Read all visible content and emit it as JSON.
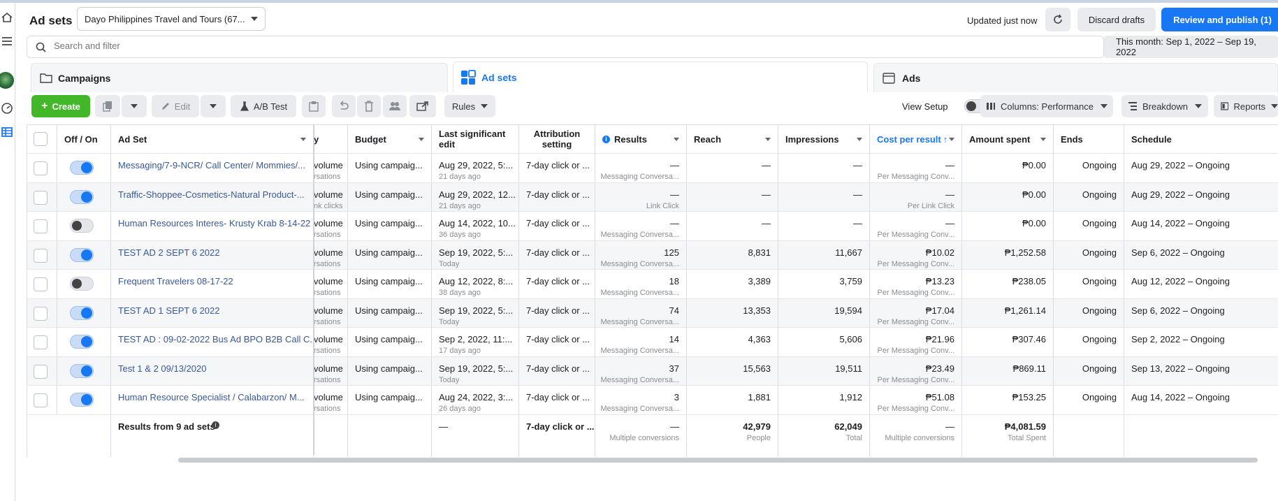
{
  "header": {
    "title": "Ad sets",
    "account": "Dayo Philippines Travel and Tours (67...",
    "updated": "Updated just now",
    "discard": "Discard drafts",
    "publish": "Review and publish (1)"
  },
  "search": {
    "placeholder": "Search and filter"
  },
  "date_range": "This month: Sep 1, 2022 – Sep 19, 2022",
  "tabs": [
    {
      "label": "Campaigns"
    },
    {
      "label": "Ad sets"
    },
    {
      "label": "Ads"
    }
  ],
  "toolbar": {
    "create": "Create",
    "edit": "Edit",
    "ab_test": "A/B Test",
    "rules": "Rules",
    "view_setup": "View Setup",
    "columns": "Columns: Performance",
    "breakdown": "Breakdown",
    "reports": "Reports"
  },
  "columns": {
    "off_on": "Off / On",
    "ad_set": "Ad Set",
    "delivery": "y",
    "budget": "Budget",
    "last_edit": "Last significant edit",
    "attribution": "Attribution setting",
    "results": "Results",
    "reach": "Reach",
    "impressions": "Impressions",
    "cpr": "Cost per result",
    "spent": "Amount spent",
    "ends": "Ends",
    "schedule": "Schedule"
  },
  "rows": [
    {
      "on": true,
      "name": "Messaging/7-9-NCR/ Call Center/ Mommies/...",
      "del": "volume",
      "del_sub": "rsations",
      "budget": "Using campaig...",
      "edit": "Aug 29, 2022, 5:...",
      "edit_sub": "21 days ago",
      "attr": "7-day click or ...",
      "results": "—",
      "results_sub": "Messaging Conversa...",
      "reach": "—",
      "impr": "—",
      "cpr": "—",
      "cpr_sub": "Per Messaging Conv...",
      "spent": "₱0.00",
      "ends": "Ongoing",
      "schedule": "Aug 29, 2022 – Ongoing"
    },
    {
      "on": true,
      "name": "Traffic-Shoppee-Cosmetics-Natural Product-...",
      "del": "volume",
      "del_sub": "nk clicks",
      "budget": "Using campaig...",
      "edit": "Aug 29, 2022, 12...",
      "edit_sub": "21 days ago",
      "attr": "7-day click or ...",
      "results": "—",
      "results_sub": "Link Click",
      "reach": "—",
      "impr": "—",
      "cpr": "—",
      "cpr_sub": "Per Link Click",
      "spent": "₱0.00",
      "ends": "Ongoing",
      "schedule": "Aug 29, 2022 – Ongoing"
    },
    {
      "on": false,
      "name": "Human Resources Interes- Krusty Krab 8-14-22",
      "del": "volume",
      "del_sub": "rsations",
      "budget": "Using campaig...",
      "edit": "Aug 14, 2022, 10...",
      "edit_sub": "36 days ago",
      "attr": "7-day click or ...",
      "results": "—",
      "results_sub": "Messaging Conversa...",
      "reach": "—",
      "impr": "—",
      "cpr": "—",
      "cpr_sub": "Per Messaging Conv...",
      "spent": "₱0.00",
      "ends": "Ongoing",
      "schedule": "Aug 14, 2022 – Ongoing"
    },
    {
      "on": true,
      "name": "TEST AD 2 SEPT 6 2022",
      "del": "volume",
      "del_sub": "rsations",
      "budget": "Using campaig...",
      "edit": "Sep 19, 2022, 5:...",
      "edit_sub": "Today",
      "attr": "7-day click or ...",
      "results": "125",
      "results_sub": "Messaging Conversa...",
      "reach": "8,831",
      "impr": "11,667",
      "cpr": "₱10.02",
      "cpr_sub": "Per Messaging Conv...",
      "spent": "₱1,252.58",
      "ends": "Ongoing",
      "schedule": "Sep 6, 2022 – Ongoing"
    },
    {
      "on": false,
      "name": "Frequent Travelers 08-17-22",
      "del": "volume",
      "del_sub": "rsations",
      "budget": "Using campaig...",
      "edit": "Aug 12, 2022, 8:...",
      "edit_sub": "38 days ago",
      "attr": "7-day click or ...",
      "results": "18",
      "results_sub": "Messaging Conversa...",
      "reach": "3,389",
      "impr": "3,759",
      "cpr": "₱13.23",
      "cpr_sub": "Per Messaging Conv...",
      "spent": "₱238.05",
      "ends": "Ongoing",
      "schedule": "Aug 12, 2022 – Ongoing"
    },
    {
      "on": true,
      "name": "TEST AD 1 SEPT 6 2022",
      "del": "volume",
      "del_sub": "rsations",
      "budget": "Using campaig...",
      "edit": "Sep 19, 2022, 5:...",
      "edit_sub": "Today",
      "attr": "7-day click or ...",
      "results": "74",
      "results_sub": "Messaging Conversa...",
      "reach": "13,353",
      "impr": "19,594",
      "cpr": "₱17.04",
      "cpr_sub": "Per Messaging Conv...",
      "spent": "₱1,261.14",
      "ends": "Ongoing",
      "schedule": "Sep 6, 2022 – Ongoing"
    },
    {
      "on": true,
      "name": "TEST AD : 09-02-2022 Bus Ad BPO B2B Call C...",
      "del": "volume",
      "del_sub": "rsations",
      "budget": "Using campaig...",
      "edit": "Sep 2, 2022, 11:...",
      "edit_sub": "17 days ago",
      "attr": "7-day click or ...",
      "results": "14",
      "results_sub": "Messaging Conversa...",
      "reach": "4,363",
      "impr": "5,606",
      "cpr": "₱21.96",
      "cpr_sub": "Per Messaging Conv...",
      "spent": "₱307.46",
      "ends": "Ongoing",
      "schedule": "Sep 2, 2022 – Ongoing"
    },
    {
      "on": true,
      "name": "Test 1 & 2 09/13/2020",
      "del": "volume",
      "del_sub": "rsations",
      "budget": "Using campaig...",
      "edit": "Sep 19, 2022, 5:...",
      "edit_sub": "Today",
      "attr": "7-day click or ...",
      "results": "37",
      "results_sub": "Messaging Conversa...",
      "reach": "15,563",
      "impr": "19,511",
      "cpr": "₱23.49",
      "cpr_sub": "Per Messaging Conv...",
      "spent": "₱869.11",
      "ends": "Ongoing",
      "schedule": "Sep 13, 2022 – Ongoing"
    },
    {
      "on": true,
      "name": "Human Resource Specialist / Calabarzon/ M...",
      "del": "volume",
      "del_sub": "rsations",
      "budget": "Using campaig...",
      "edit": "Aug 24, 2022, 3:...",
      "edit_sub": "26 days ago",
      "attr": "7-day click or ...",
      "results": "3",
      "results_sub": "Messaging Conversa...",
      "reach": "1,881",
      "impr": "1,912",
      "cpr": "₱51.08",
      "cpr_sub": "Per Messaging Conv...",
      "spent": "₱153.25",
      "ends": "Ongoing",
      "schedule": "Aug 14, 2022 – Ongoing"
    }
  ],
  "summary": {
    "label": "Results from 9 ad sets",
    "edit": "—",
    "attr": "7-day click or ...",
    "results": "—",
    "results_sub": "Multiple conversions",
    "reach": "42,979",
    "reach_sub": "People",
    "impr": "62,049",
    "impr_sub": "Total",
    "cpr": "—",
    "cpr_sub": "Multiple conversions",
    "spent": "₱4,081.59",
    "spent_sub": "Total Spent"
  },
  "colors": {
    "accent": "#1877f2",
    "create": "#42b72a",
    "link": "#385898"
  }
}
